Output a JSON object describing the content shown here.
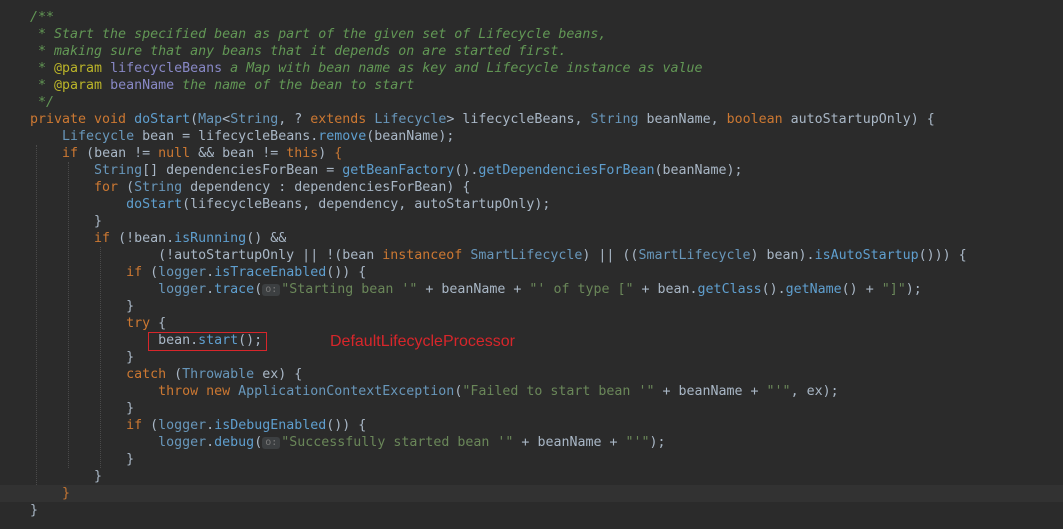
{
  "editor": {
    "annotation_text": "DefaultLifecycleProcessor",
    "colors": {
      "background": "#2b2b2b",
      "current_line": "#323232",
      "comment": "#629755",
      "keyword": "#cc7832",
      "type": "#6897bb",
      "method": "#5f9fcf",
      "string": "#6a8759",
      "highlight_box": "#d7262b"
    },
    "lines": [
      [
        {
          "t": "/**",
          "c": "comment"
        }
      ],
      [
        {
          "t": " * Start the specified bean as part of the given set of Lifecycle beans,",
          "c": "comment"
        }
      ],
      [
        {
          "t": " * making sure that any beans that it depends on are started first.",
          "c": "comment"
        }
      ],
      [
        {
          "t": " * ",
          "c": "comment"
        },
        {
          "t": "@param",
          "c": "ann"
        },
        {
          "t": " ",
          "c": "comment"
        },
        {
          "t": "lifecycleBeans",
          "c": "param"
        },
        {
          "t": " a Map with bean name as key and Lifecycle instance as value",
          "c": "comment"
        }
      ],
      [
        {
          "t": " * ",
          "c": "comment"
        },
        {
          "t": "@param",
          "c": "ann"
        },
        {
          "t": " ",
          "c": "comment"
        },
        {
          "t": "beanName",
          "c": "param"
        },
        {
          "t": " the name of the bean to start",
          "c": "comment"
        }
      ],
      [
        {
          "t": " */",
          "c": "comment"
        }
      ],
      [
        {
          "t": "private void ",
          "c": "kw"
        },
        {
          "t": "doStart",
          "c": "method"
        },
        {
          "t": "(",
          "c": ""
        },
        {
          "t": "Map",
          "c": "type"
        },
        {
          "t": "<",
          "c": ""
        },
        {
          "t": "String",
          "c": "type"
        },
        {
          "t": ", ? ",
          "c": ""
        },
        {
          "t": "extends ",
          "c": "kw"
        },
        {
          "t": "Lifecycle",
          "c": "type"
        },
        {
          "t": "> lifecycleBeans, ",
          "c": ""
        },
        {
          "t": "String",
          "c": "type"
        },
        {
          "t": " beanName, ",
          "c": ""
        },
        {
          "t": "boolean ",
          "c": "kw"
        },
        {
          "t": "autoStartupOnly) {",
          "c": ""
        }
      ],
      [
        {
          "t": "    ",
          "c": ""
        },
        {
          "t": "Lifecycle",
          "c": "type"
        },
        {
          "t": " bean = lifecycleBeans.",
          "c": ""
        },
        {
          "t": "remove",
          "c": "method"
        },
        {
          "t": "(beanName);",
          "c": ""
        }
      ],
      [
        {
          "t": "    ",
          "c": ""
        },
        {
          "t": "if ",
          "c": "kw"
        },
        {
          "t": "(bean != ",
          "c": ""
        },
        {
          "t": "null ",
          "c": "kw"
        },
        {
          "t": "&& bean != ",
          "c": ""
        },
        {
          "t": "this",
          "c": "kw"
        },
        {
          "t": ") ",
          "c": ""
        },
        {
          "t": "{",
          "c": "brace-warn"
        }
      ],
      [
        {
          "t": "        ",
          "c": ""
        },
        {
          "t": "String",
          "c": "type"
        },
        {
          "t": "[] dependenciesForBean = ",
          "c": ""
        },
        {
          "t": "getBeanFactory",
          "c": "method"
        },
        {
          "t": "().",
          "c": ""
        },
        {
          "t": "getDependenciesForBean",
          "c": "method"
        },
        {
          "t": "(beanName);",
          "c": ""
        }
      ],
      [
        {
          "t": "        ",
          "c": ""
        },
        {
          "t": "for ",
          "c": "kw"
        },
        {
          "t": "(",
          "c": ""
        },
        {
          "t": "String",
          "c": "type"
        },
        {
          "t": " dependency : dependenciesForBean) {",
          "c": ""
        }
      ],
      [
        {
          "t": "            ",
          "c": ""
        },
        {
          "t": "doStart",
          "c": "method"
        },
        {
          "t": "(lifecycleBeans, dependency, autoStartupOnly);",
          "c": ""
        }
      ],
      [
        {
          "t": "        }",
          "c": ""
        }
      ],
      [
        {
          "t": "        ",
          "c": ""
        },
        {
          "t": "if ",
          "c": "kw"
        },
        {
          "t": "(!bean.",
          "c": ""
        },
        {
          "t": "isRunning",
          "c": "method"
        },
        {
          "t": "() &&",
          "c": ""
        }
      ],
      [
        {
          "t": "                (!autoStartupOnly || !(bean ",
          "c": ""
        },
        {
          "t": "instanceof ",
          "c": "kw"
        },
        {
          "t": "SmartLifecycle",
          "c": "type"
        },
        {
          "t": ") || ((",
          "c": ""
        },
        {
          "t": "SmartLifecycle",
          "c": "type"
        },
        {
          "t": ") bean).",
          "c": ""
        },
        {
          "t": "isAutoStartup",
          "c": "method"
        },
        {
          "t": "())) {",
          "c": ""
        }
      ],
      [
        {
          "t": "            ",
          "c": ""
        },
        {
          "t": "if ",
          "c": "kw"
        },
        {
          "t": "(",
          "c": ""
        },
        {
          "t": "logger",
          "c": "type"
        },
        {
          "t": ".",
          "c": ""
        },
        {
          "t": "isTraceEnabled",
          "c": "method"
        },
        {
          "t": "()) {",
          "c": ""
        }
      ],
      [
        {
          "t": "                ",
          "c": ""
        },
        {
          "t": "logger",
          "c": "type"
        },
        {
          "t": ".",
          "c": ""
        },
        {
          "t": "trace",
          "c": "method"
        },
        {
          "t": "(",
          "c": ""
        },
        {
          "t": "o:",
          "c": "hint"
        },
        {
          "t": "\"Starting bean '\"",
          "c": "string"
        },
        {
          "t": " + beanName + ",
          "c": ""
        },
        {
          "t": "\"' of type [\"",
          "c": "string"
        },
        {
          "t": " + bean.",
          "c": ""
        },
        {
          "t": "getClass",
          "c": "method"
        },
        {
          "t": "().",
          "c": ""
        },
        {
          "t": "getName",
          "c": "method"
        },
        {
          "t": "() + ",
          "c": ""
        },
        {
          "t": "\"]\"",
          "c": "string"
        },
        {
          "t": ");",
          "c": ""
        }
      ],
      [
        {
          "t": "            }",
          "c": ""
        }
      ],
      [
        {
          "t": "            ",
          "c": ""
        },
        {
          "t": "try ",
          "c": "kw"
        },
        {
          "t": "{",
          "c": ""
        }
      ],
      [
        {
          "t": "                bean.",
          "c": ""
        },
        {
          "t": "start",
          "c": "method"
        },
        {
          "t": "();",
          "c": ""
        }
      ],
      [
        {
          "t": "            }",
          "c": ""
        }
      ],
      [
        {
          "t": "            ",
          "c": ""
        },
        {
          "t": "catch ",
          "c": "kw"
        },
        {
          "t": "(",
          "c": ""
        },
        {
          "t": "Throwable",
          "c": "type"
        },
        {
          "t": " ex) {",
          "c": ""
        }
      ],
      [
        {
          "t": "                ",
          "c": ""
        },
        {
          "t": "throw new ",
          "c": "kw"
        },
        {
          "t": "ApplicationContextException",
          "c": "type"
        },
        {
          "t": "(",
          "c": ""
        },
        {
          "t": "\"Failed to start bean '\"",
          "c": "string"
        },
        {
          "t": " + beanName + ",
          "c": ""
        },
        {
          "t": "\"'\"",
          "c": "string"
        },
        {
          "t": ", ex);",
          "c": ""
        }
      ],
      [
        {
          "t": "            }",
          "c": ""
        }
      ],
      [
        {
          "t": "            ",
          "c": ""
        },
        {
          "t": "if ",
          "c": "kw"
        },
        {
          "t": "(",
          "c": ""
        },
        {
          "t": "logger",
          "c": "type"
        },
        {
          "t": ".",
          "c": ""
        },
        {
          "t": "isDebugEnabled",
          "c": "method"
        },
        {
          "t": "()) {",
          "c": ""
        }
      ],
      [
        {
          "t": "                ",
          "c": ""
        },
        {
          "t": "logger",
          "c": "type"
        },
        {
          "t": ".",
          "c": ""
        },
        {
          "t": "debug",
          "c": "method"
        },
        {
          "t": "(",
          "c": ""
        },
        {
          "t": "o:",
          "c": "hint"
        },
        {
          "t": "\"Successfully started bean '\"",
          "c": "string"
        },
        {
          "t": " + beanName + ",
          "c": ""
        },
        {
          "t": "\"'\"",
          "c": "string"
        },
        {
          "t": ");",
          "c": ""
        }
      ],
      [
        {
          "t": "            }",
          "c": ""
        }
      ],
      [
        {
          "t": "        }",
          "c": ""
        }
      ],
      [
        {
          "t": "    ",
          "c": ""
        },
        {
          "t": "}",
          "c": "brace-warn"
        }
      ],
      [
        {
          "t": "}",
          "c": ""
        }
      ]
    ]
  }
}
